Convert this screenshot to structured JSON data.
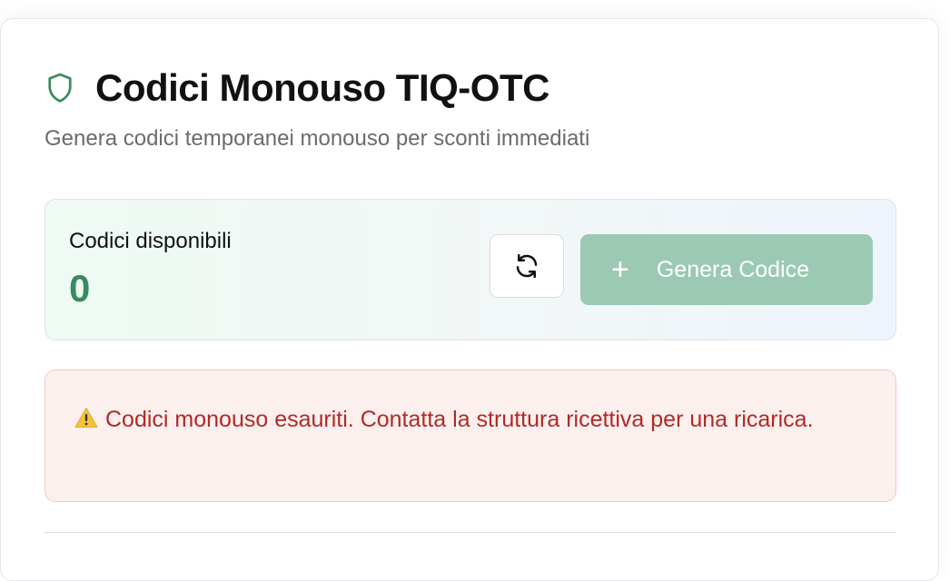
{
  "header": {
    "icon": "shield-icon",
    "title": "Codici Monouso TIQ-OTC",
    "subtitle": "Genera codici temporanei monouso per sconti immediati",
    "accent_color": "#3a8a5f"
  },
  "availability": {
    "label": "Codici disponibili",
    "count": "0",
    "refresh_icon": "refresh-icon",
    "generate_icon": "plus-icon",
    "generate_label": "Genera Codice",
    "generate_disabled": true
  },
  "alert": {
    "icon": "warning-icon",
    "message": "Codici monouso esauriti. Contatta la struttura ricettiva per una ricarica.",
    "text_color": "#b02a25"
  }
}
